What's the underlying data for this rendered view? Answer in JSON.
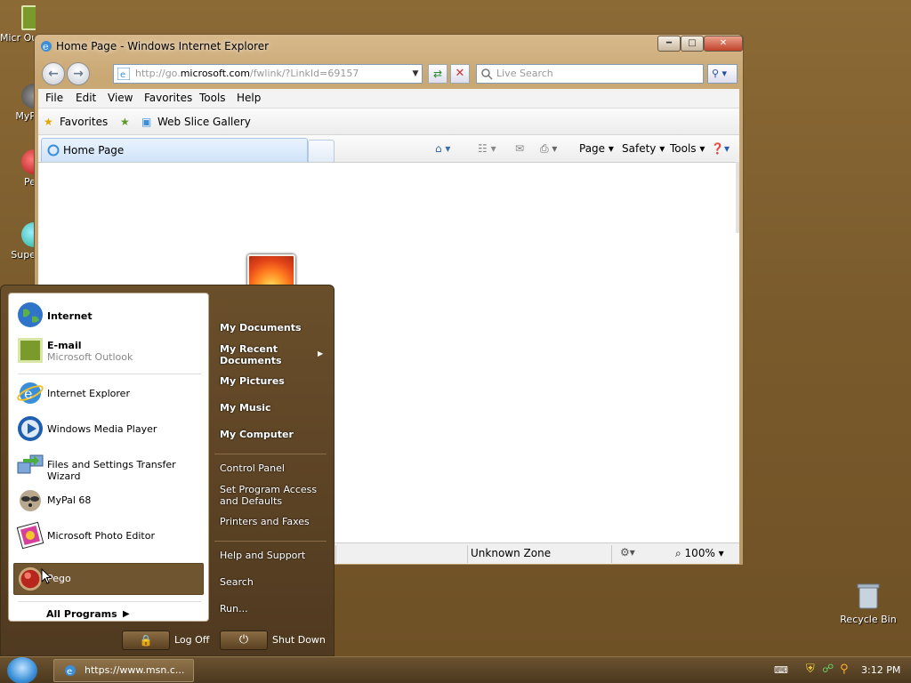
{
  "desktop": {
    "icons": [
      {
        "label": "Micr Out",
        "icon": "outlook-icon"
      },
      {
        "label": "MyP",
        "icon": "mypal-icon"
      },
      {
        "label": "Pe",
        "icon": "pego-icon"
      },
      {
        "label": "Supe",
        "icon": "super-icon"
      }
    ],
    "recycle_bin": "Recycle Bin"
  },
  "ie": {
    "window_title": "Home Page - Windows Internet Explorer",
    "address": {
      "prefix": "http://go.",
      "domain": "microsoft.com",
      "suffix": "/fwlink/?LinkId=69157"
    },
    "search_placeholder": "Live Search",
    "menu": [
      "File",
      "Edit",
      "View",
      "Favorites",
      "Tools",
      "Help"
    ],
    "favorites_label": "Favorites",
    "web_slice_label": "Web Slice Gallery",
    "tab_label": "Home Page",
    "commands": {
      "page": "Page",
      "safety": "Safety",
      "tools": "Tools"
    },
    "status": {
      "zone": "Unknown Zone",
      "zoom": "100%"
    }
  },
  "start_menu": {
    "pinned": [
      {
        "label": "Internet",
        "icon": "globe-icon"
      },
      {
        "label": "E-mail",
        "sub": "Microsoft Outlook",
        "icon": "outlook-icon"
      }
    ],
    "recent": [
      {
        "label": "Internet Explorer",
        "icon": "ie-icon"
      },
      {
        "label": "Windows Media Player",
        "icon": "media-player-icon"
      },
      {
        "label": "Files and Settings Transfer Wizard",
        "icon": "transfer-wizard-icon"
      },
      {
        "label": "MyPal 68",
        "icon": "raccoon-icon"
      },
      {
        "label": "Microsoft Photo Editor",
        "icon": "photo-editor-icon"
      },
      {
        "label": "Pego",
        "icon": "pego-icon"
      }
    ],
    "all_programs": "All Programs",
    "right": [
      "My Documents",
      "My Recent Documents",
      "My Pictures",
      "My Music",
      "My Computer",
      "Control Panel",
      "Set Program Access and Defaults",
      "Printers and Faxes",
      "Help and Support",
      "Search",
      "Run..."
    ],
    "log_off": "Log Off",
    "shut_down": "Shut Down"
  },
  "taskbar": {
    "task_label": "https://www.msn.c...",
    "clock": "3:12 PM"
  }
}
